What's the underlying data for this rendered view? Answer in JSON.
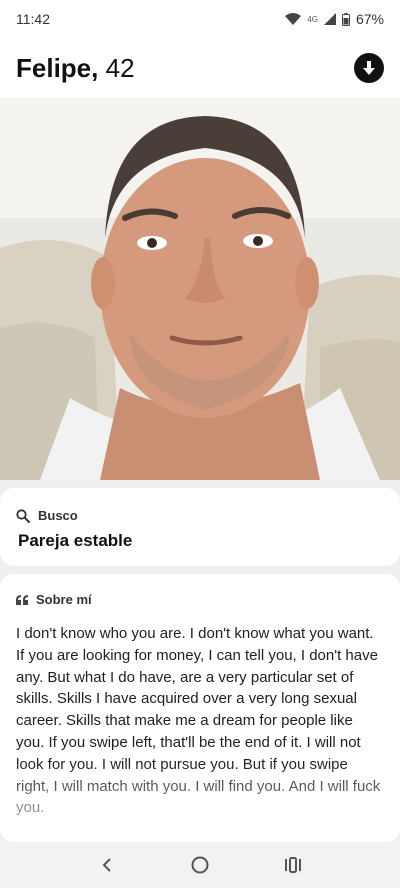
{
  "status_bar": {
    "time": "11:42",
    "network": "4G",
    "battery": "67%"
  },
  "profile": {
    "name": "Felipe",
    "age": "42",
    "photo_icon": "profile-photo"
  },
  "looking_for": {
    "heading": "Busco",
    "value": "Pareja estable"
  },
  "about": {
    "heading": "Sobre mí",
    "text": "I don't know who you are. I don't know what you want. If you are looking for money, I can tell you, I don't have any. But what I do have, are a very particular set of skills. Skills I have acquired over a very long sexual career. Skills that make me a dream for people like you. If you swipe left, that'll be the end of it. I will not look for you. I will not pursue you. But if you swipe right, I will match with you. I will find you. And I will fuck you."
  },
  "colors": {
    "background": "#efefef",
    "card": "#ffffff",
    "text": "#1a1a1a"
  }
}
